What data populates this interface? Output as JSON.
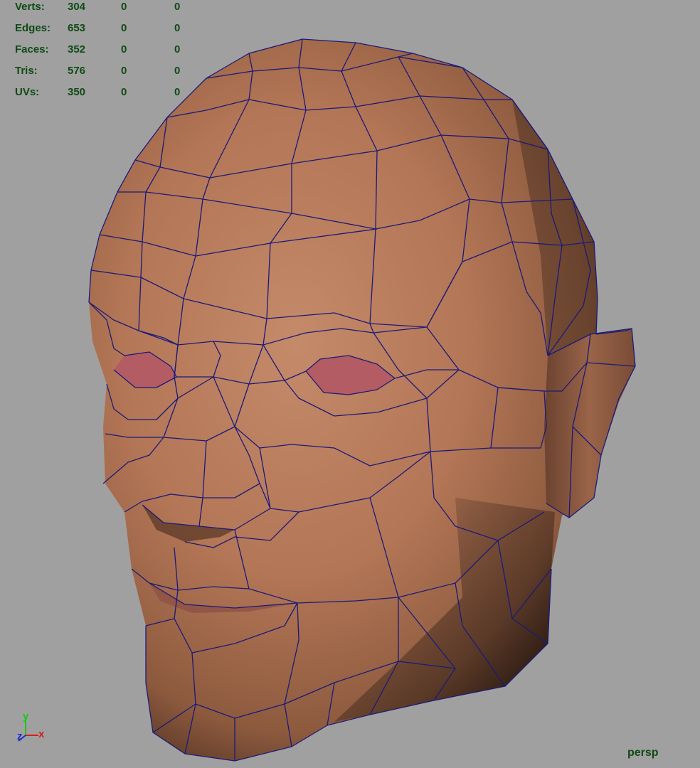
{
  "heads_up_display": {
    "rows": [
      {
        "label": "Verts:",
        "values": [
          "304",
          "0",
          "0"
        ]
      },
      {
        "label": "Edges:",
        "values": [
          "653",
          "0",
          "0"
        ]
      },
      {
        "label": "Faces:",
        "values": [
          "352",
          "0",
          "0"
        ]
      },
      {
        "label": "Tris:",
        "values": [
          "576",
          "0",
          "0"
        ]
      },
      {
        "label": "UVs:",
        "values": [
          "350",
          "0",
          "0"
        ]
      }
    ]
  },
  "camera": {
    "label": "persp"
  },
  "axis_gizmo": {
    "y": "y",
    "z": "z",
    "x": "x"
  },
  "colors": {
    "background": "#a0a0a0",
    "hud_text": "#0f4a14",
    "skin": "#b77a5c",
    "wireframe": "#1a1a7a",
    "eyes": "#b35c63",
    "axis_x": "#d42020",
    "axis_y": "#18c818",
    "axis_z": "#1a2ed0"
  },
  "icons": {
    "axis": "xyz-axis-icon"
  }
}
